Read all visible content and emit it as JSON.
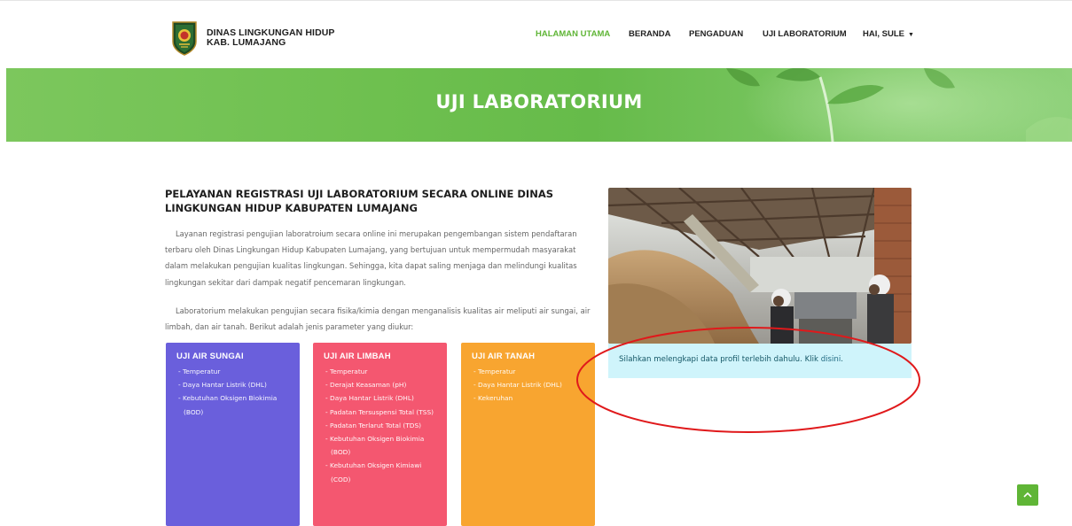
{
  "brand": {
    "line1": "DINAS LINGKUNGAN HIDUP",
    "line2": "KAB. LUMAJANG",
    "logo_icon": "regency-shield-logo"
  },
  "nav": {
    "items": [
      {
        "label": "HALAMAN UTAMA",
        "active": true
      },
      {
        "label": "BERANDA",
        "active": false
      },
      {
        "label": "PENGADUAN",
        "active": false
      },
      {
        "label": "UJI LABORATORIUM",
        "active": false
      }
    ],
    "user_menu": "HAI, SULE",
    "caret_icon": "caret-down-icon"
  },
  "banner": {
    "title": "UJI LABORATORIUM"
  },
  "content": {
    "headline": "PELAYANAN REGISTRASI UJI LABORATORIUM SECARA ONLINE DINAS LINGKUNGAN HIDUP KABUPATEN LUMAJANG",
    "paragraph1": "Layanan registrasi pengujian laboratroium secara online ini merupakan pengembangan sistem pendaftaran terbaru oleh Dinas Lingkungan Hidup Kabupaten Lumajang, yang bertujuan untuk mempermudah masyarakat dalam melakukan pengujian kualitas lingkungan. Sehingga, kita dapat saling menjaga dan melindungi kualitas lingkungan sekitar dari dampak negatif pencemaran lingkungan.",
    "paragraph2": "Laboratorium melakukan pengujian secara fisika/kimia dengan menganalisis kualitas air meliputi air sungai, air limbah, dan air tanah. Berikut adalah jenis parameter yang diukur:"
  },
  "cards": [
    {
      "title": "UJI AIR SUNGAI",
      "items": [
        "- Temperatur",
        "- Daya Hantar Listrik (DHL)",
        "- Kebutuhan Oksigen Biokimia (BOD)"
      ]
    },
    {
      "title": "UJI AIR LIMBAH",
      "items": [
        "- Temperatur",
        "- Derajat Keasaman (pH)",
        "- Daya Hantar Listrik (DHL)",
        "- Padatan Tersuspensi Total (TSS)",
        "- Padatan Terlarut Total (TDS)",
        "- Kebutuhan Oksigen Biokimia (BOD)",
        "- Kebutuhan Oksigen Kimiawi (COD)"
      ]
    },
    {
      "title": "UJI AIR TANAH",
      "items": [
        "- Temperatur",
        "- Daya Hantar Listrik (DHL)",
        "- Kekeruhan"
      ]
    }
  ],
  "alert": {
    "text": "Silahkan melengkapi data profil terlebih dahulu. Klik ",
    "link": "disini",
    "suffix": "."
  },
  "colors": {
    "accent_green": "#5fb536",
    "card_sungai": "#6a5fdc",
    "card_limbah": "#f45770",
    "card_tanah": "#f8a530",
    "alert_bg": "#cff4fb",
    "annotation_red": "#e0191b"
  },
  "scroll_top_icon": "chevron-up-icon"
}
